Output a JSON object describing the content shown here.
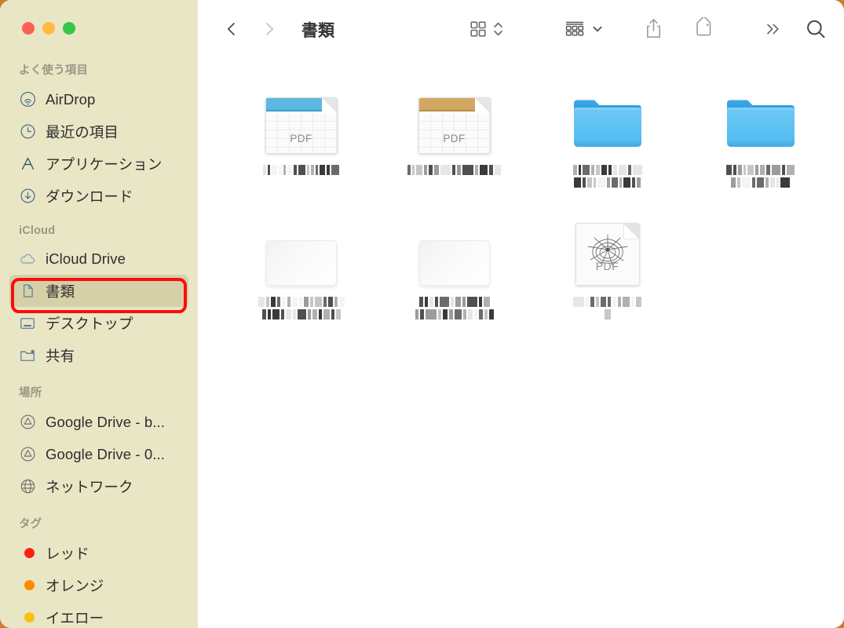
{
  "window": {
    "title": "書類",
    "backdrop_color": "#c97f2e",
    "sidebar_color": "#e9e6c5",
    "content_color": "#ffffff",
    "traffic_lights": [
      {
        "name": "close",
        "color": "#fc6058"
      },
      {
        "name": "minimize",
        "color": "#fdbc40"
      },
      {
        "name": "maximize",
        "color": "#34c749"
      }
    ]
  },
  "toolbar": {
    "back_label": "戻る",
    "forward_label": "進む",
    "back_enabled": true,
    "forward_enabled": false,
    "title": "書類",
    "view_as_label": "表示方法",
    "arrange_label": "グループ分け",
    "share_label": "共有",
    "tags_label": "タグ",
    "more_label": "その他",
    "search_label": "検索"
  },
  "sidebar": {
    "sections": [
      {
        "title": "よく使う項目",
        "items": [
          {
            "label": "AirDrop",
            "icon": "airdrop-icon"
          },
          {
            "label": "最近の項目",
            "icon": "clock-icon"
          },
          {
            "label": "アプリケーション",
            "icon": "applications-icon"
          },
          {
            "label": "ダウンロード",
            "icon": "downloads-icon"
          }
        ]
      },
      {
        "title": "iCloud",
        "items": [
          {
            "label": "iCloud Drive",
            "icon": "cloud-icon",
            "selected": false
          },
          {
            "label": "書類",
            "icon": "document-icon",
            "selected": true
          },
          {
            "label": "デスクトップ",
            "icon": "desktop-icon",
            "selected": false
          },
          {
            "label": "共有",
            "icon": "shared-folder-icon",
            "selected": false
          }
        ]
      },
      {
        "title": "場所",
        "items": [
          {
            "label": "Google Drive - b...",
            "icon": "google-drive-icon"
          },
          {
            "label": "Google Drive - 0...",
            "icon": "google-drive-icon"
          },
          {
            "label": "ネットワーク",
            "icon": "network-globe-icon"
          }
        ]
      },
      {
        "title": "タグ",
        "items": [
          {
            "label": "レッド",
            "icon": "tag-dot-icon",
            "color": "#ff1f12"
          },
          {
            "label": "オレンジ",
            "icon": "tag-dot-icon",
            "color": "#ff8a00"
          },
          {
            "label": "イエロー",
            "icon": "tag-dot-icon",
            "color": "#fdc00f"
          }
        ]
      }
    ],
    "selection_annotation": {
      "target": "書類",
      "color": "#fb0d0d"
    }
  },
  "files": [
    {
      "name_redacted": true,
      "kind": "pdf-calendar",
      "badge": "PDF",
      "accent": "blue",
      "name_lines": [
        [
          4,
          3,
          7,
          4,
          3,
          6,
          4,
          9,
          3,
          4,
          3,
          7,
          4,
          10
        ]
      ]
    },
    {
      "name_redacted": true,
      "kind": "pdf-calendar",
      "badge": "PDF",
      "accent": "orange",
      "name_lines": [
        [
          4,
          3,
          8,
          4,
          5,
          6,
          13,
          4,
          5,
          14,
          4,
          10,
          5,
          8
        ]
      ]
    },
    {
      "name_redacted": true,
      "kind": "folder",
      "badge": "",
      "accent": "",
      "name_lines": [
        [
          5,
          3,
          9,
          4,
          5,
          7,
          4,
          5,
          10,
          4,
          12
        ],
        [
          9,
          4,
          6,
          3,
          10,
          4,
          8,
          3,
          9,
          4,
          5
        ]
      ]
    },
    {
      "name_redacted": true,
      "kind": "folder",
      "badge": "",
      "accent": "",
      "name_lines": [
        [
          7,
          4,
          5,
          3,
          8,
          4,
          6,
          5,
          11,
          4,
          10
        ],
        [
          6,
          4,
          11,
          4,
          9,
          4,
          6,
          3,
          12
        ]
      ]
    },
    {
      "name_redacted": true,
      "kind": "blank-preview",
      "badge": "",
      "accent": "",
      "name_lines": [
        [
          8,
          4,
          6,
          4,
          5,
          4,
          7,
          4,
          6,
          4,
          9,
          4,
          6,
          4,
          7
        ],
        [
          5,
          4,
          9,
          4,
          7,
          4,
          11,
          4,
          6,
          4,
          8,
          4,
          6
        ]
      ]
    },
    {
      "name_redacted": true,
      "kind": "blank-preview",
      "badge": "",
      "accent": "",
      "name_lines": [
        [
          5,
          4,
          5,
          4,
          12,
          4,
          7,
          4,
          13,
          4,
          8
        ],
        [
          4,
          5,
          14,
          4,
          6,
          5,
          9,
          4,
          6,
          4,
          5,
          4,
          6
        ]
      ]
    },
    {
      "name_redacted": true,
      "kind": "pdf-web",
      "badge": "PDF",
      "accent": "",
      "name_lines": [
        [
          14,
          4,
          5,
          4,
          7,
          4,
          5,
          4,
          9,
          4,
          7
        ],
        [
          8
        ]
      ]
    }
  ]
}
